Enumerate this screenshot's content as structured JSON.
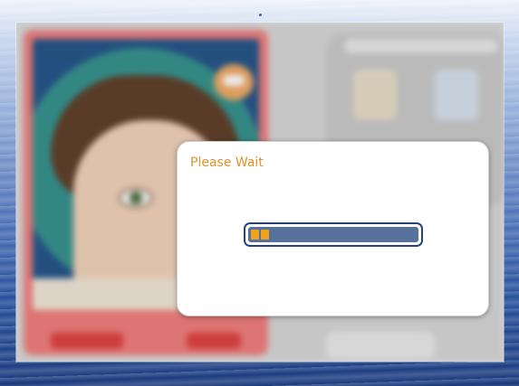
{
  "dialog": {
    "title": "Please Wait",
    "progress_percent": 10
  },
  "colors": {
    "title_text": "#e0922b",
    "progress_fill": "#f0a21a",
    "progress_track": "#55719c",
    "progress_border": "#25437a",
    "dialog_bg": "#ffffff"
  }
}
